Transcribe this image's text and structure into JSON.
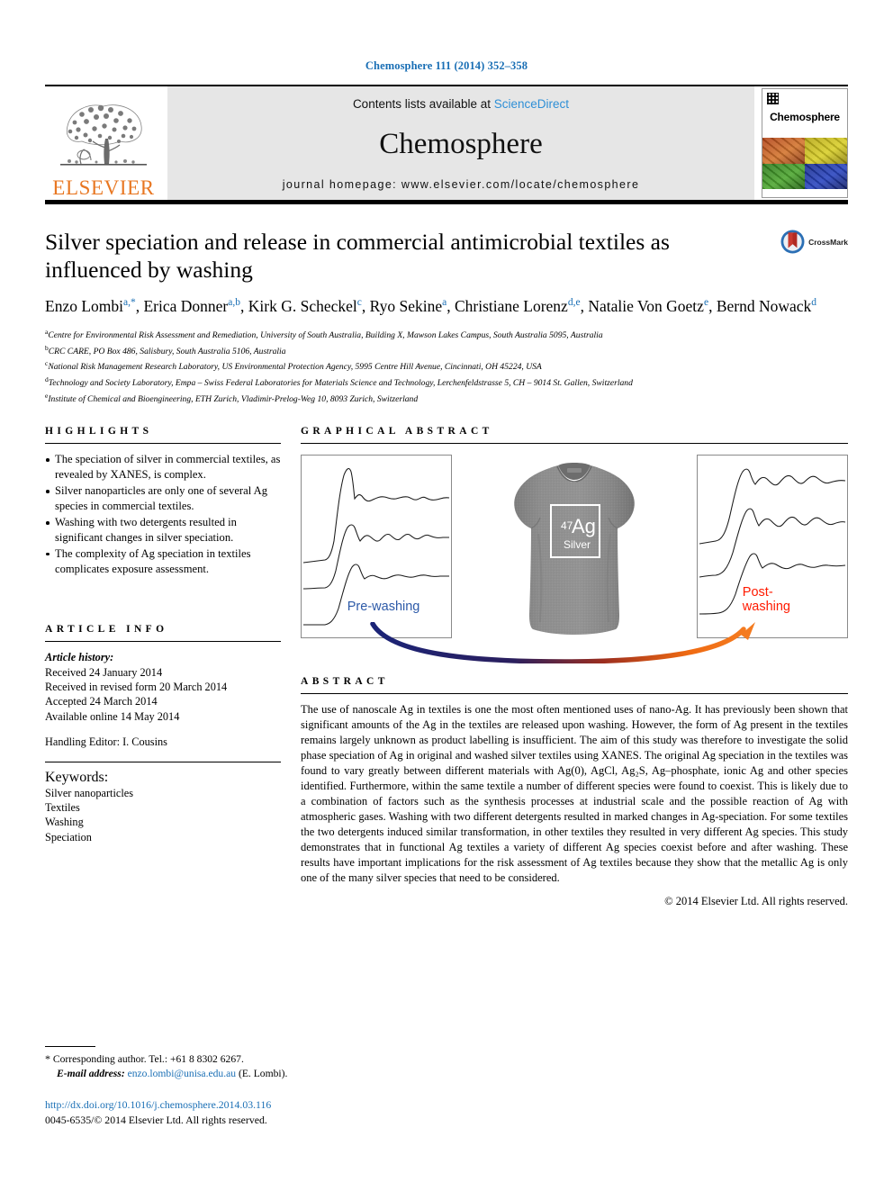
{
  "running_head": "Chemosphere 111 (2014) 352–358",
  "masthead": {
    "contents_prefix": "Contents lists available at ",
    "sciencedirect": "ScienceDirect",
    "journal_name": "Chemosphere",
    "homepage": "journal homepage: www.elsevier.com/locate/chemosphere",
    "publisher": "ELSEVIER",
    "cover_title": "Chemosphere"
  },
  "article": {
    "title": "Silver speciation and release in commercial antimicrobial textiles as influenced by washing",
    "crossmark_label": "CrossMark",
    "authors": [
      {
        "name": "Enzo Lombi",
        "sup": "a,*"
      },
      {
        "name": "Erica Donner",
        "sup": "a,b"
      },
      {
        "name": "Kirk G. Scheckel",
        "sup": "c"
      },
      {
        "name": "Ryo Sekine",
        "sup": "a"
      },
      {
        "name": "Christiane Lorenz",
        "sup": "d,e"
      },
      {
        "name": "Natalie Von Goetz",
        "sup": "e"
      },
      {
        "name": "Bernd Nowack",
        "sup": "d"
      }
    ],
    "affiliations": [
      {
        "mark": "a",
        "text": "Centre for Environmental Risk Assessment and Remediation, University of South Australia, Building X, Mawson Lakes Campus, South Australia 5095, Australia"
      },
      {
        "mark": "b",
        "text": "CRC CARE, PO Box 486, Salisbury, South Australia 5106, Australia"
      },
      {
        "mark": "c",
        "text": "National Risk Management Research Laboratory, US Environmental Protection Agency, 5995 Centre Hill Avenue, Cincinnati, OH 45224, USA"
      },
      {
        "mark": "d",
        "text": "Technology and Society Laboratory, Empa – Swiss Federal Laboratories for Materials Science and Technology, Lerchenfeldstrasse 5, CH – 9014 St. Gallen, Switzerland"
      },
      {
        "mark": "e",
        "text": "Institute of Chemical and Bioengineering, ETH Zurich, Vladimir-Prelog-Weg 10, 8093 Zurich, Switzerland"
      }
    ]
  },
  "highlights": {
    "heading": "HIGHLIGHTS",
    "items": [
      "The speciation of silver in commercial textiles, as revealed by XANES, is complex.",
      "Silver nanoparticles are only one of several Ag species in commercial textiles.",
      "Washing with two detergents resulted in significant changes in silver speciation.",
      "The complexity of Ag speciation in textiles complicates exposure assessment."
    ]
  },
  "graphical_abstract": {
    "heading": "GRAPHICAL ABSTRACT",
    "left_panel_label": "Pre-washing",
    "right_panel_label": "Post-washing",
    "shirt_symbol_superscript": "47",
    "shirt_symbol": "Ag",
    "shirt_element_name": "Silver",
    "arrow_start_color": "#1b2477",
    "arrow_end_color": "#f47b20"
  },
  "article_info": {
    "heading": "ARTICLE INFO",
    "history_label": "Article history:",
    "history": [
      "Received 24 January 2014",
      "Received in revised form 20 March 2014",
      "Accepted 24 March 2014",
      "Available online 14 May 2014"
    ],
    "handling_editor": "Handling Editor: I. Cousins",
    "keywords_label": "Keywords:",
    "keywords": [
      "Silver nanoparticles",
      "Textiles",
      "Washing",
      "Speciation"
    ]
  },
  "abstract": {
    "heading": "ABSTRACT",
    "text": "The use of nanoscale Ag in textiles is one the most often mentioned uses of nano-Ag. It has previously been shown that significant amounts of the Ag in the textiles are released upon washing. However, the form of Ag present in the textiles remains largely unknown as product labelling is insufficient. The aim of this study was therefore to investigate the solid phase speciation of Ag in original and washed silver textiles using XANES. The original Ag speciation in the textiles was found to vary greatly between different materials with Ag(0), AgCl, Ag₂S, Ag–phosphate, ionic Ag and other species identified. Furthermore, within the same textile a number of different species were found to coexist. This is likely due to a combination of factors such as the synthesis processes at industrial scale and the possible reaction of Ag with atmospheric gases. Washing with two different detergents resulted in marked changes in Ag-speciation. For some textiles the two detergents induced similar transformation, in other textiles they resulted in very different Ag species. This study demonstrates that in functional Ag textiles a variety of different Ag species coexist before and after washing. These results have important implications for the risk assessment of Ag textiles because they show that the metallic Ag is only one of the many silver species that need to be considered.",
    "copyright": "© 2014 Elsevier Ltd. All rights reserved."
  },
  "footnotes": {
    "corresponding_marker": "*",
    "corresponding": "Corresponding author. Tel.: +61 8 8302 6267.",
    "email_label": "E-mail address:",
    "email": "enzo.lombi@unisa.edu.au",
    "email_owner": "(E. Lombi).",
    "doi_url": "http://dx.doi.org/10.1016/j.chemosphere.2014.03.116",
    "issn_copyright": "0045-6535/© 2014 Elsevier Ltd. All rights reserved."
  }
}
